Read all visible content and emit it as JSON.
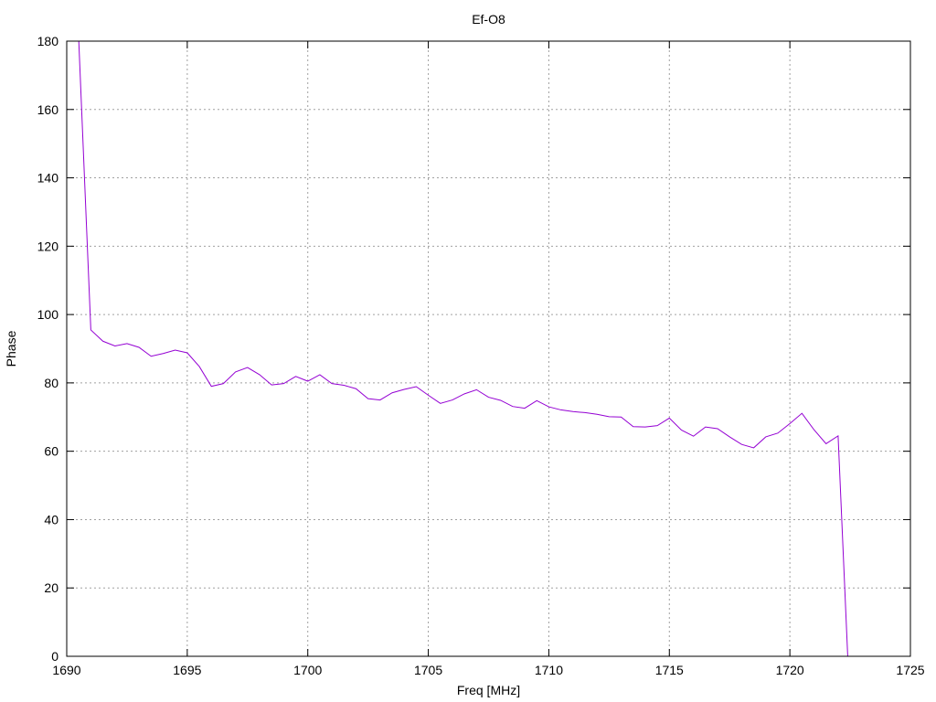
{
  "chart_data": {
    "type": "line",
    "title": "Ef-O8",
    "xlabel": "Freq [MHz]",
    "ylabel": "Phase",
    "xlim": [
      1690,
      1725
    ],
    "ylim": [
      0,
      180
    ],
    "xticks": [
      1690,
      1695,
      1700,
      1705,
      1710,
      1715,
      1720,
      1725
    ],
    "yticks": [
      0,
      20,
      40,
      60,
      80,
      100,
      120,
      140,
      160,
      180
    ],
    "grid": true,
    "line_color": "#9400d3",
    "series": [
      {
        "x": [
          1690.5,
          1691.0,
          1691.5,
          1692.0,
          1692.5,
          1693.0,
          1693.5,
          1694.0,
          1694.5,
          1695.0,
          1695.5,
          1696.0,
          1696.5,
          1697.0,
          1697.5,
          1698.0,
          1698.5,
          1699.0,
          1699.5,
          1700.0,
          1700.5,
          1701.0,
          1701.5,
          1702.0,
          1702.5,
          1703.0,
          1703.5,
          1704.0,
          1704.5,
          1705.0,
          1705.5,
          1706.0,
          1706.5,
          1707.0,
          1707.5,
          1708.0,
          1708.5,
          1709.0,
          1709.5,
          1710.0,
          1710.5,
          1711.0,
          1711.5,
          1712.0,
          1712.5,
          1713.0,
          1713.5,
          1714.0,
          1714.5,
          1715.0,
          1715.5,
          1716.0,
          1716.5,
          1717.0,
          1717.5,
          1718.0,
          1718.5,
          1719.0,
          1719.5,
          1720.0,
          1720.5,
          1721.0,
          1721.5,
          1722.0,
          1722.4
        ],
        "values": [
          180,
          95.5,
          92.2,
          90.8,
          91.5,
          90.4,
          87.8,
          88.6,
          89.6,
          88.8,
          84.8,
          79.0,
          79.8,
          83.2,
          84.5,
          82.4,
          79.4,
          79.8,
          81.9,
          80.5,
          82.4,
          79.8,
          79.3,
          78.3,
          75.4,
          75.0,
          77.1,
          78.1,
          78.9,
          76.4,
          74.0,
          75.0,
          76.8,
          78.0,
          75.8,
          74.9,
          73.1,
          72.6,
          74.8,
          73.0,
          72.1,
          71.6,
          71.3,
          70.8,
          70.1,
          70.0,
          67.2,
          67.1,
          67.5,
          69.7,
          66.2,
          64.4,
          67.1,
          66.6,
          64.2,
          62.0,
          61.0,
          64.2,
          65.3,
          68.1,
          71.1,
          66.3,
          62.2,
          64.5,
          0
        ]
      }
    ]
  }
}
